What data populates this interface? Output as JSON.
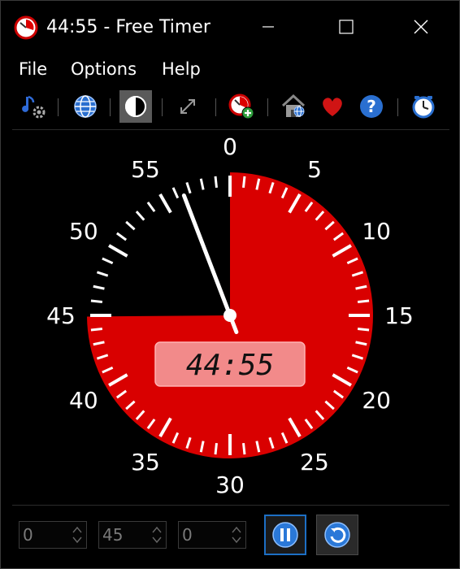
{
  "window": {
    "title": "44:55 - Free Timer"
  },
  "menu": {
    "items": [
      {
        "label": "File"
      },
      {
        "label": "Options"
      },
      {
        "label": "Help"
      }
    ]
  },
  "toolbar": {
    "buttons": [
      {
        "icon": "sound-settings-icon"
      },
      {
        "icon": "globe-icon"
      },
      {
        "icon": "contrast-icon",
        "active": true
      },
      {
        "icon": "resize-icon"
      },
      {
        "icon": "add-timer-icon"
      },
      {
        "icon": "home-icon"
      },
      {
        "icon": "heart-icon"
      },
      {
        "icon": "help-icon"
      },
      {
        "icon": "clock-icon"
      }
    ]
  },
  "dial": {
    "minute_labels": [
      "0",
      "5",
      "10",
      "15",
      "20",
      "25",
      "30",
      "35",
      "40",
      "45",
      "50",
      "55"
    ],
    "remaining_minutes": 44.92,
    "hand_minute": 56.5,
    "display_time": "44:55",
    "colors": {
      "fill": "#d90000",
      "ticks": "#ffffff",
      "hand": "#ffffff",
      "lcd_bg": "#f28a8a",
      "lcd_text": "#111111"
    }
  },
  "controls": {
    "hours_value": "0",
    "minutes_value": "45",
    "seconds_value": "0",
    "pause_icon": "pause-icon",
    "reset_icon": "reset-icon"
  }
}
